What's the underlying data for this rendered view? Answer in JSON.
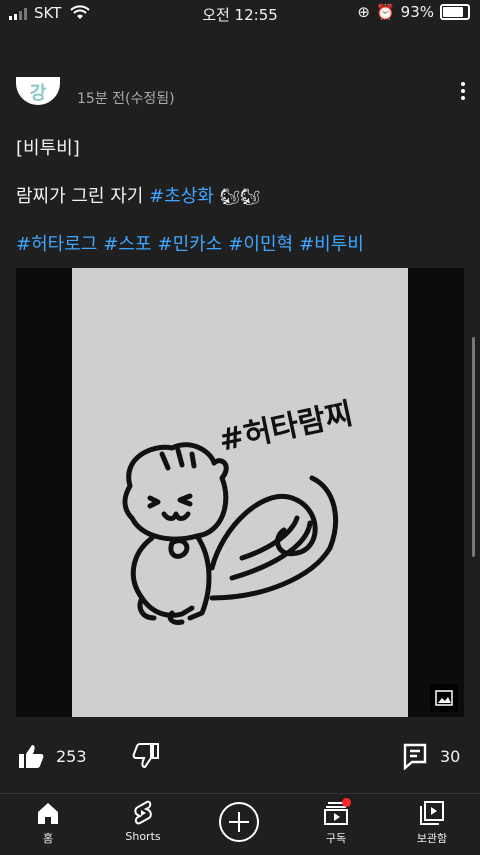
{
  "status": {
    "carrier": "SKT",
    "time": "오전 12:55",
    "battery": "93%",
    "battery_level": 0.93
  },
  "post": {
    "avatar_text": "강",
    "meta": "15분 전(수정됨)",
    "line1": "[비투비]",
    "line2_text": "람찌가 그린 자기 ",
    "line2_tag": "#초상화",
    "line2_emoji": "🐿🐿",
    "hashtags": [
      "#허타로그",
      "#스포",
      "#민카소",
      "#이민혁",
      "#비투비"
    ],
    "image_caption": "#허타람찌"
  },
  "actions": {
    "likes": "253",
    "comments": "30"
  },
  "nav": {
    "home": "홈",
    "shorts": "Shorts",
    "subscriptions": "구독",
    "library": "보관함"
  }
}
